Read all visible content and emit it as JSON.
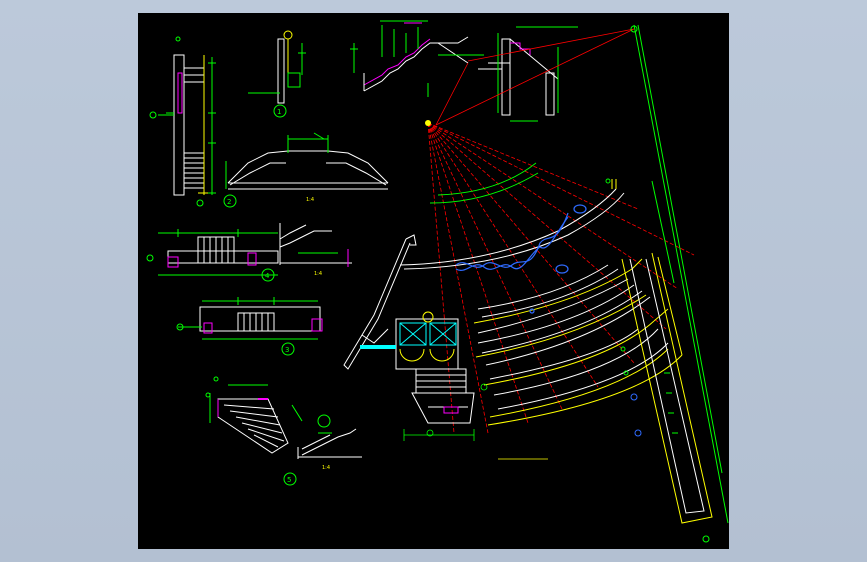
{
  "colors": {
    "background": "#000000",
    "viewport": "#b8c5d6",
    "wall": "#ffffff",
    "dimension": "#00ff00",
    "axis": "#ff0000",
    "outline": "#ffff00",
    "handrail": "#ff00ff",
    "glass": "#00ffff",
    "accent_blue": "#2f6bff"
  },
  "detail_markers": {
    "d1": "1",
    "d2": "2",
    "d3": "3",
    "d4": "4",
    "d5": "5"
  },
  "scale_note": "1:4"
}
